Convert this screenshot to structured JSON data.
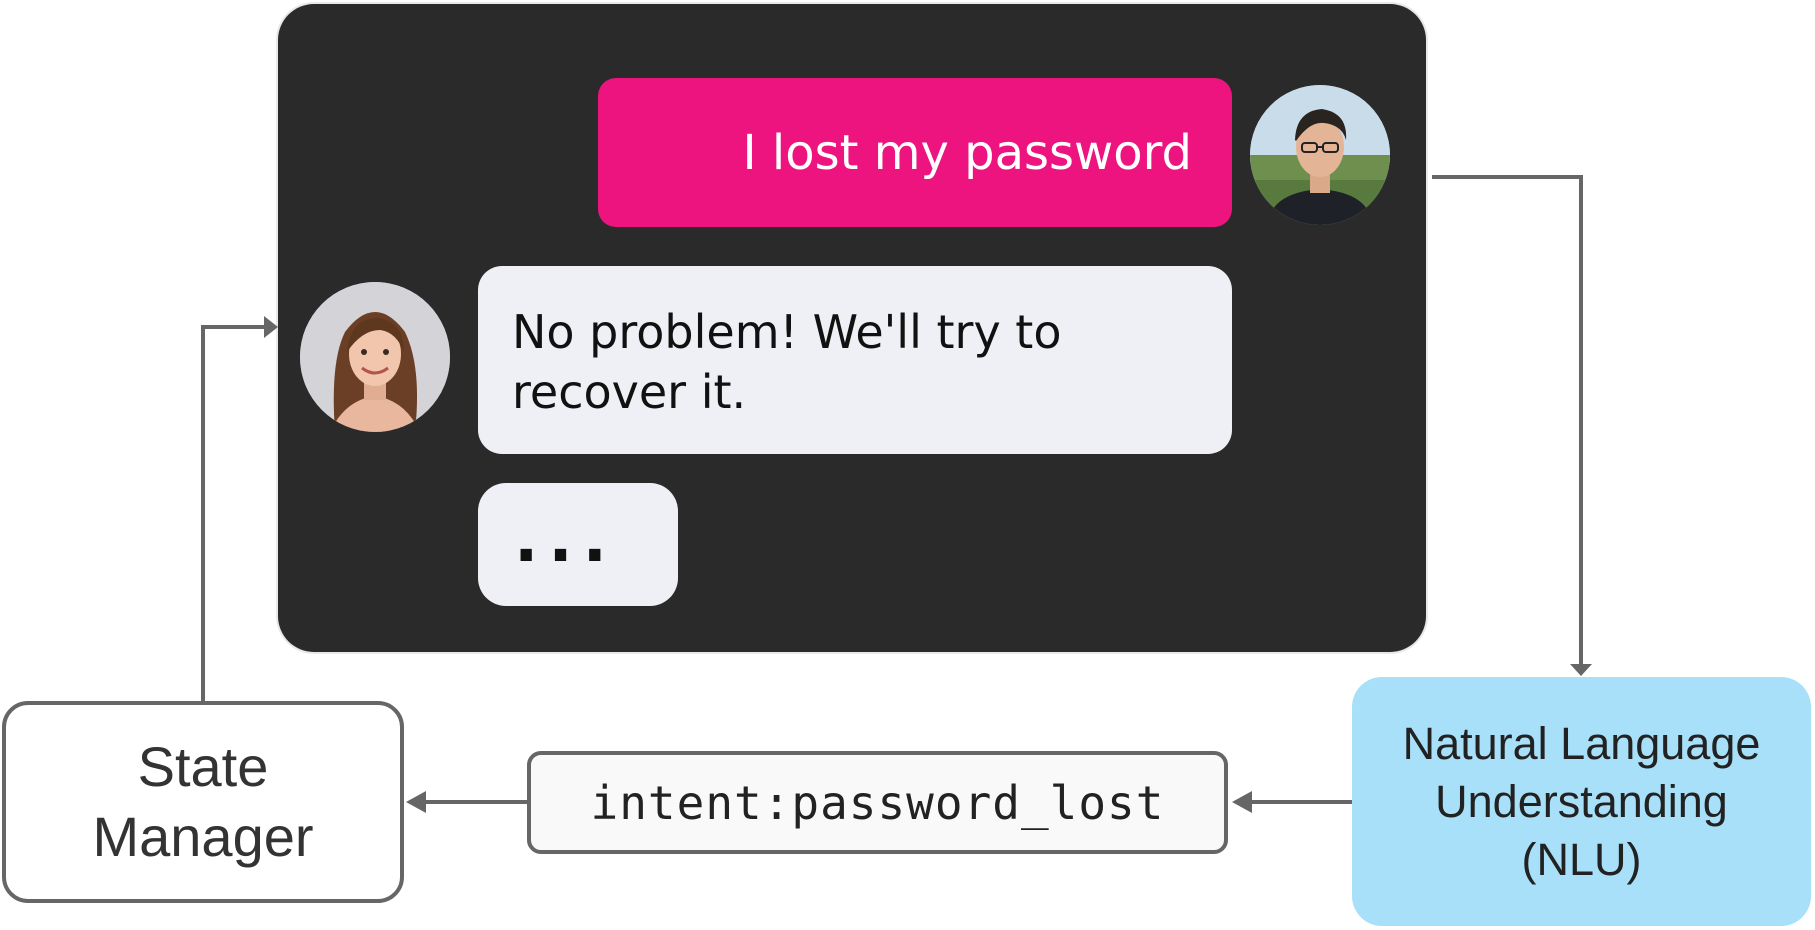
{
  "chat": {
    "user_message": "I lost my password",
    "bot_message": "No problem! We'll try to recover it.",
    "typing_indicator": "..."
  },
  "state_manager": {
    "label_line1": "State",
    "label_line2": "Manager"
  },
  "intent": {
    "label": "intent:password_lost"
  },
  "nlu": {
    "label_line1": "Natural Language",
    "label_line2": "Understanding",
    "label_line3": "(NLU)"
  },
  "colors": {
    "chat_background": "#2a2a2a",
    "user_bubble": "#ee1480",
    "bot_bubble": "#eef0f5",
    "nlu_box": "#a7e0f8",
    "arrow": "#666666"
  }
}
